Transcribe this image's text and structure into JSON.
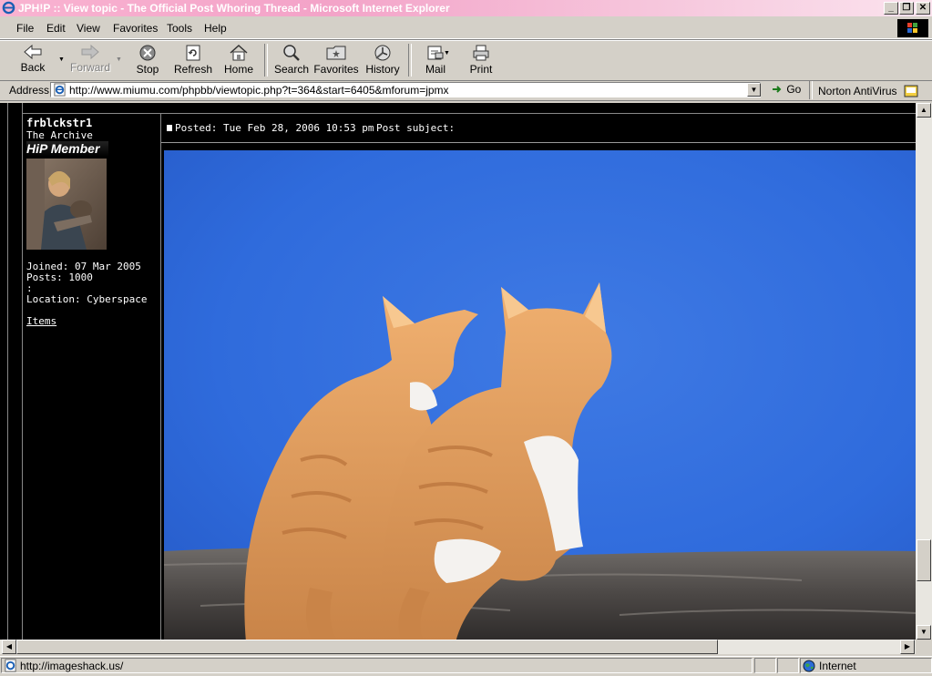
{
  "window": {
    "title": "JPH!P :: View topic - The Official Post Whoring Thread - Microsoft Internet Explorer",
    "btn_minimize": "_",
    "btn_restore": "❐",
    "btn_close": "✕"
  },
  "menu": {
    "items": [
      "File",
      "Edit",
      "View",
      "Favorites",
      "Tools",
      "Help"
    ]
  },
  "toolbar": {
    "back": "Back",
    "forward": "Forward",
    "stop": "Stop",
    "refresh": "Refresh",
    "home": "Home",
    "search": "Search",
    "favorites": "Favorites",
    "history": "History",
    "mail": "Mail",
    "print": "Print"
  },
  "address": {
    "label": "Address",
    "url": "http://www.miumu.com/phpbb/viewtopic.php?t=364&start=6405&mforum=jpmx",
    "go": "Go",
    "norton": "Norton AntiVirus"
  },
  "post": {
    "username": "frblckstr1",
    "user_title": "The Archive",
    "rank_image_text": "HiP Member",
    "joined": "Joined: 07 Mar 2005",
    "posts": "Posts: 1000",
    "extra": ":",
    "location": "Location: Cyberspace",
    "items_link": "Items",
    "posted": "Posted: Tue Feb 28, 2006 10:53 pm",
    "subject": "Post subject:"
  },
  "status": {
    "text": "http://imageshack.us/",
    "zone": "Internet"
  }
}
